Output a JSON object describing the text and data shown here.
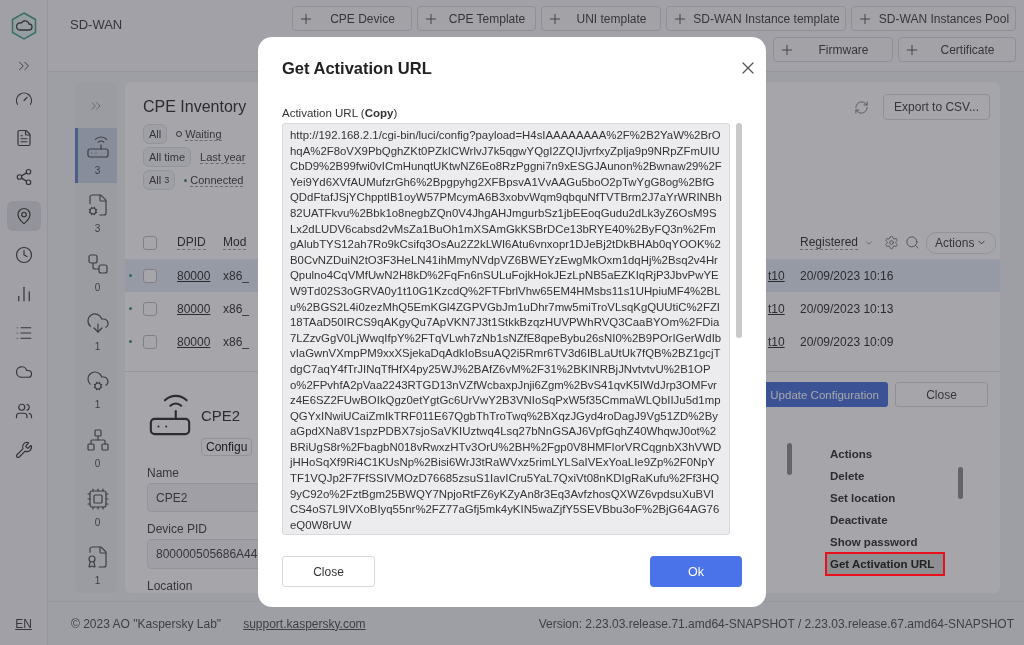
{
  "app": {
    "title": "SD-WAN",
    "language": "EN"
  },
  "nav": [
    {
      "selected": false
    },
    {
      "selected": false
    },
    {
      "selected": false
    },
    {
      "selected": true
    },
    {
      "selected": false
    },
    {
      "selected": false
    },
    {
      "selected": false
    },
    {
      "selected": false
    },
    {
      "selected": false
    },
    {
      "selected": false
    }
  ],
  "create_buttons": [
    [
      "CPE Device",
      "CPE Template",
      "UNI template",
      "SD-WAN Instance template",
      "SD-WAN Instances Pool"
    ],
    [
      "Firmware",
      "Certificate"
    ]
  ],
  "categories": [
    {
      "count": "3",
      "selected": true
    },
    {
      "count": "3",
      "selected": false
    },
    {
      "count": "0",
      "selected": false
    },
    {
      "count": "1",
      "selected": false
    },
    {
      "count": "1",
      "selected": false
    },
    {
      "count": "0",
      "selected": false
    },
    {
      "count": "0",
      "selected": false
    },
    {
      "count": "1",
      "selected": false
    }
  ],
  "inventory": {
    "title": "CPE Inventory",
    "export_button": "Export to CSV...",
    "filters": [
      [
        {
          "label": "All",
          "selected": true
        },
        {
          "label": "Waiting",
          "selected": false,
          "kind": "ring"
        }
      ],
      [
        {
          "label": "All time",
          "selected": true
        },
        {
          "label": "Last year",
          "selected": false
        }
      ],
      [
        {
          "label": "All",
          "count": "3",
          "selected": true
        },
        {
          "label": "Connected",
          "selected": false,
          "kind": "dot"
        }
      ]
    ],
    "select_all_checked": false,
    "columns": [
      "DPID",
      "Mod",
      "Registered"
    ],
    "actions_button": "Actions",
    "rows": [
      {
        "dpid": "80000",
        "model": "x86_",
        "column_3": "t10",
        "registered": "20/09/2023 10:16",
        "selected": true,
        "checked": false
      },
      {
        "dpid": "80000",
        "model": "x86_",
        "column_3": "t10",
        "registered": "20/09/2023 10:13",
        "selected": false,
        "checked": false
      },
      {
        "dpid": "80000",
        "model": "x86_",
        "column_3": "t10",
        "registered": "20/09/2023 10:09",
        "selected": false,
        "checked": false
      }
    ]
  },
  "details": {
    "name": "CPE2",
    "configure_button": "Configu",
    "update_button": "Update Configuration",
    "close_button": "Close",
    "fields": [
      {
        "label": "Name",
        "value": "CPE2"
      },
      {
        "label": "Device PID",
        "value": "800000505686A44"
      },
      {
        "label": "Location"
      }
    ],
    "actions_menu": [
      {
        "label": "Actions",
        "highlighted": false
      },
      {
        "label": "Delete",
        "highlighted": false
      },
      {
        "label": "Set location",
        "highlighted": false
      },
      {
        "label": "Deactivate",
        "highlighted": false
      },
      {
        "label": "Show password",
        "highlighted": false
      },
      {
        "label": "Get Activation URL",
        "highlighted": true
      }
    ]
  },
  "footer": {
    "copyright": "© 2023 AO \"Kaspersky Lab\"",
    "link": "support.kaspersky.com",
    "version": "Version: 2.23.03.release.71.amd64-SNAPSHOT / 2.23.03.release.67.amd64-SNAPSHOT"
  },
  "dialog": {
    "title": "Get Activation URL",
    "field_label": "Activation URL (**Copy**)",
    "url": "http://192.168.2.1/cgi-bin/luci/config?payload=H4sIAAAAAAAA%2F%2B2YaW%2BrOhqA%2F8oVX9PbQghZKt0PZkICWrlvJ7k5qgwYQgI2ZQIJjvrfxyZplja9p9NRpZFmUIUCbD9%2B99fwi0vICmHunqtUKtwNZ6Eo8RzPggni7n9xESGJAunon%2Bwnaw29%2FYei9Yd6XVfAUMufzrGh6%2Bpgpyhg2XFBpsvA1VvAAGu5boO2pTwYgG8og%2BfGQDdFtafJSjYChpptIB1oyW57PMcymA6B3xobvWqm9qbquNfTVTBrm2J7aYrWRINBh82UATFkvu%2Bbk1o8negbZQn0V4JhgAHJmgurbSz1jbEEoqGudu2dLk3yZ6OsM9SLx2dLUDV6cabsd2vMsZa1BuOh1mXSAmGkKSBrDCe13bRYE40%2ByFQ3n%2FmgAlubTYS12ah7Ro9kCsifq3OsAu2Z2kLWI6Atu6vnxopr1DJeBj2tDkBHAb0qYOOK%2B0CvNZDuiN2tO3F3HeLN41ihMmyNVdpVZ6BWEYzEwgMkOxm1dqHj%2Bsq2v4HrQpulno4CqVMfUwN2H8kD%2FqFn6nSULuFojkHokJEzLpNB5aEZKIqRjP3JbvPwYEW9Td02S3oGRVA0y1t10G1KzcdQ%2FTFbrlVhw65EM4HMsbs11s1UHpiuMF4%2BLu%2BGS2L4i0zezMhQ5EmKGl4ZGPVGbJm1uDhr7mw5miTroVLsqKgQUUtiC%2FZI18TAaD50IRCS9qAKgyQu7ApVKN7J3t1StkkBzqzHUVPWhRVQ3CaaBYOm%2FDia7LZzvGgV0LjWwqIfpY%2FTqVLwh7zNb1sNZfE8qpeBybu26sNI0%2B9POrIGerWdIbvIaGwnVXmpPM9xxXSjekaDqAdkIoBsuAQ2i5Rmr6TV3d6IBLaUtUk7fQB%2BZ1gcjTdgC7aqY4fTrJINqTfHfX4py25WJ%2BAfZ6vM%2F31%2BKINRBjJNvtvtvU%2B1OPo%2FPvhfA2pVaa2243RTGD13nVZfWcbaxpJnji6Zgm%2BvS41qvK5IWdJrp3OMFvrz4E6SZ2FUwBOIkQgz0etYgtGc6UrVwY2B3VNIoSqPxW5f35CmmaWLQbIIJu5d1mpQGYxINwiUCaiZmIkTRF011E67QgbThTroTwq%2BXqzJGyd4roDagJ9Vg51ZD%2ByaGpdXNa8V1spzPDBX7sjoSaVKIUztwq4Lsq27bNnGSAJ6VpfGqhZ40WhqwJ0ot%2BRiUgS8r%2FbagbN018vRwxzHTv3OrU%2BH%2Fgp0V8HMFIorVRCqgnbX3hVWDjHHoSqXf9Ri4C1KUsNp%2Bisi6WrJ3tRaWVxz5rimLYLSaIVExYoaLIe9Zp%2F0NpYTF1VQJp2F7FfSSIVMOzD76685zsuS1IavICru5YaL7QxiVt08nKDIgRaKufu%2Ff3HQ9yC92o%2FztBgm25BWQY7NpjoRtFZ6yKZyAn8r3Eq3AvfzhosQXWZ6vpdsuXuBVICS4oS7L9IVXoBIyq55nr%2FZ77aGfj5mk4yKIN5waZjfY5SEVBbu3oF%2BjG64AG76eQ0W8rUW",
    "cancel_button": "Close",
    "ok_button": "Ok"
  }
}
